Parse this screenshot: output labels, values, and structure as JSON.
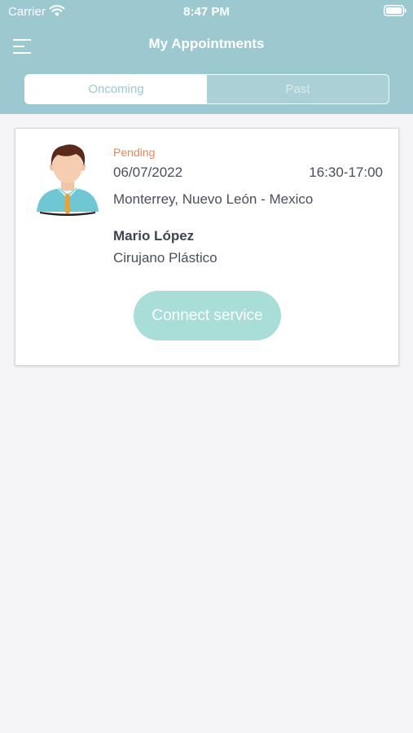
{
  "status_bar": {
    "carrier": "Carrier",
    "time": "8:47 PM",
    "wifi_icon": "wifi-icon",
    "battery_icon": "battery-icon"
  },
  "nav": {
    "title": "My Appointments",
    "menu_icon": "menu-icon"
  },
  "tabs": [
    {
      "label": "Oncoming",
      "selected": true
    },
    {
      "label": "Past",
      "selected": false
    }
  ],
  "appointment": {
    "status": "Pending",
    "date": "06/07/2022",
    "time": "16:30-17:00",
    "location": "Monterrey, Nuevo León - Mexico",
    "doctor_name": "Mario López",
    "specialty": "Cirujano Plástico",
    "avatar_icon": "doctor-avatar",
    "action_label": "Connect service"
  },
  "colors": {
    "header": "#9bc9cf",
    "pending": "#e8875c",
    "connect_button": "#a8ddd8",
    "background": "#f5f5f7"
  }
}
